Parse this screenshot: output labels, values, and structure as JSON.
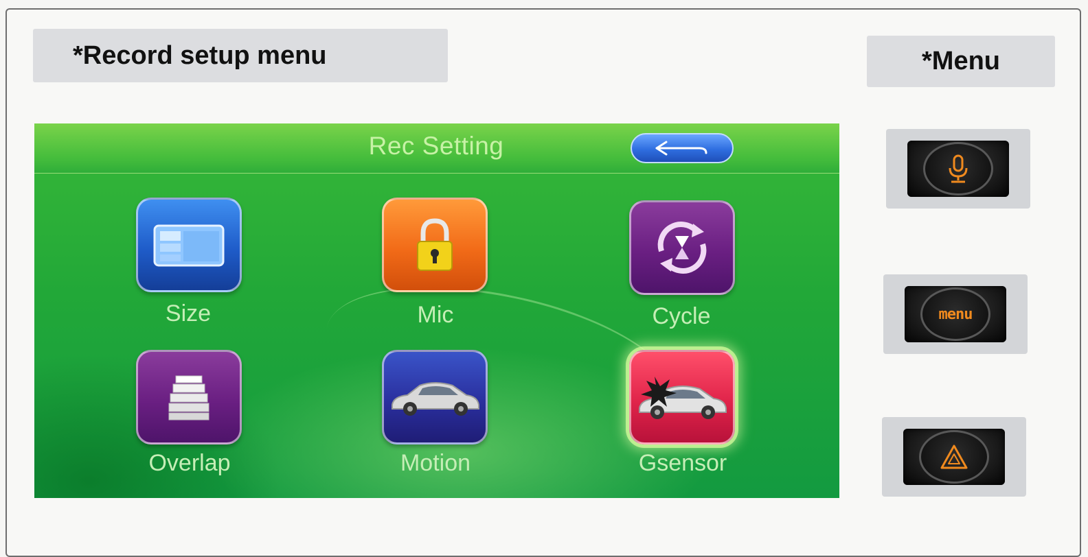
{
  "header": {
    "record_label": "*Record setup menu",
    "menu_label": "*Menu"
  },
  "screen": {
    "title": "Rec Setting",
    "back_icon": "back-arrow-icon",
    "items": [
      {
        "id": "size",
        "label": "Size",
        "icon": "size-icon",
        "color": "#1f5cc9"
      },
      {
        "id": "mic",
        "label": "Mic",
        "icon": "padlock-icon",
        "color": "#f26b18"
      },
      {
        "id": "cycle",
        "label": "Cycle",
        "icon": "cycle-icon",
        "color": "#6a1f82"
      },
      {
        "id": "overlap",
        "label": "Overlap",
        "icon": "stack-icon",
        "color": "#6a1f82"
      },
      {
        "id": "motion",
        "label": "Motion",
        "icon": "car-icon",
        "color": "#2a2f9e"
      },
      {
        "id": "gsensor",
        "label": "Gsensor",
        "icon": "car-crash-icon",
        "color": "#e0244a",
        "selected": true
      }
    ]
  },
  "hardware_buttons": [
    {
      "id": "mic-button",
      "icon": "microphone-icon",
      "accent": "#f08a1e"
    },
    {
      "id": "menu-button",
      "icon": "menu-icon",
      "text": "menu",
      "accent": "#f08a1e"
    },
    {
      "id": "hazard-button",
      "icon": "warning-triangle-icon",
      "accent": "#f08a1e"
    }
  ]
}
